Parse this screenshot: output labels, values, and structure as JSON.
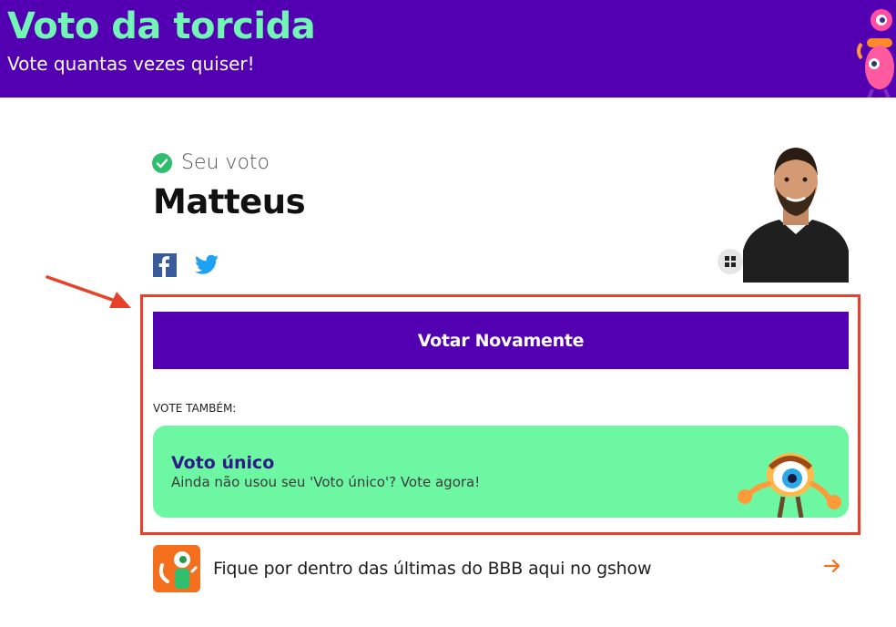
{
  "header": {
    "title": "Voto da torcida",
    "subtitle": "Vote quantas vezes quiser!"
  },
  "vote": {
    "status_label": "Seu voto",
    "candidate_name": "Matteus"
  },
  "actions": {
    "vote_again_label": "Votar Novamente"
  },
  "also": {
    "section_label": "VOTE TAMBÉM:",
    "card_title": "Voto único",
    "card_description": "Ainda não usou seu 'Voto único'? Vote agora!"
  },
  "news": {
    "text": "Fique por dentro das últimas do BBB aqui no gshow"
  },
  "colors": {
    "brand_purple": "#5200b2",
    "title_green": "#73f5b6",
    "card_green": "#6ef7a3",
    "highlight_red": "#e8412a",
    "check_green": "#2fbd6e",
    "news_arrow": "#f5701e"
  },
  "icons": {
    "check": "check-circle-icon",
    "facebook": "facebook-icon",
    "twitter": "twitter-icon",
    "grid": "grid-icon",
    "arrow": "arrow-right-icon"
  }
}
